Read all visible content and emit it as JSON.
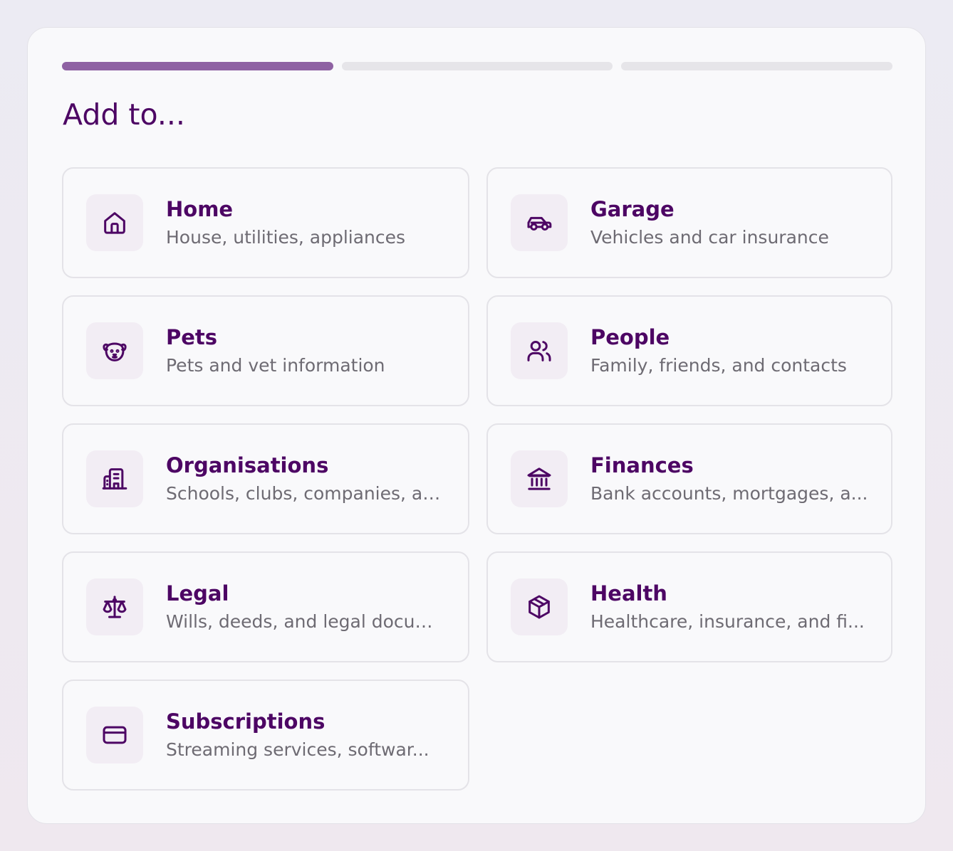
{
  "title": "Add to...",
  "progress": {
    "total_steps": 3,
    "current_step": 1
  },
  "colors": {
    "accent": "#4d0664",
    "progress_active": "#8f62a3",
    "progress_inactive": "#e6e5e9",
    "icon_background": "#f2edf4",
    "description_text": "#6e6b73"
  },
  "categories": [
    {
      "label": "Home",
      "description": "House, utilities, appliances",
      "icon": "home-icon"
    },
    {
      "label": "Garage",
      "description": "Vehicles and car insurance",
      "icon": "car-icon"
    },
    {
      "label": "Pets",
      "description": "Pets and vet information",
      "icon": "dog-icon"
    },
    {
      "label": "People",
      "description": "Family, friends, and contacts",
      "icon": "users-icon"
    },
    {
      "label": "Organisations",
      "description": "Schools, clubs, companies, an...",
      "icon": "building-icon"
    },
    {
      "label": "Finances",
      "description": "Bank accounts, mortgages, a...",
      "icon": "bank-icon"
    },
    {
      "label": "Legal",
      "description": "Wills, deeds, and legal docum...",
      "icon": "scale-icon"
    },
    {
      "label": "Health",
      "description": "Healthcare, insurance, and fi...",
      "icon": "box-icon"
    },
    {
      "label": "Subscriptions",
      "description": "Streaming services, softwar...",
      "icon": "credit-card-icon"
    }
  ]
}
